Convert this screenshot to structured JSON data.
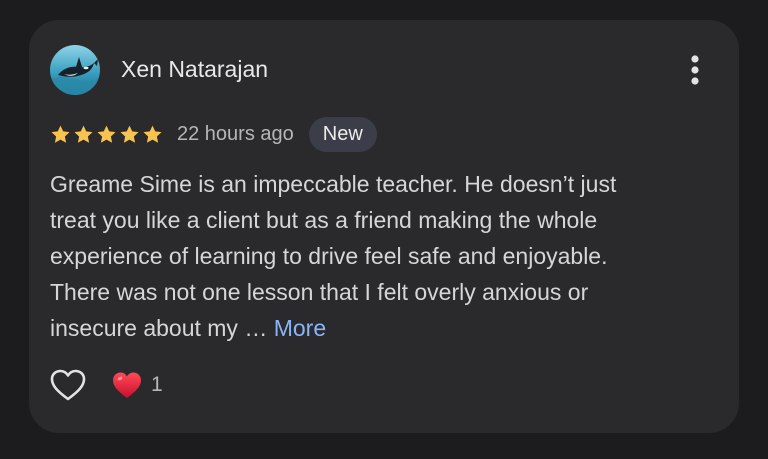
{
  "review": {
    "reviewer_name": "Xen Natarajan",
    "avatar_icon": "orca-avatar-icon",
    "rating": 5,
    "rating_max": 5,
    "time_ago": "22 hours ago",
    "badge": "New",
    "text_lines": [
      "Greame Sime is an impeccable teacher. He doesn’t just",
      "treat you like a client but as a friend making the whole",
      "experience of learning to drive feel safe and enjoyable.",
      "There was not one lesson that I felt overly anxious or",
      "insecure about my … "
    ],
    "more_label": "More"
  },
  "actions": {
    "like_icon": "heart-outline-icon",
    "reaction_icon": "red-heart-icon",
    "reaction_count": "1",
    "menu_icon": "more-vert-icon"
  },
  "colors": {
    "background": "#1c1c1e",
    "card": "#2a2a2c",
    "star": "#f8c44f",
    "link": "#8ab4f8",
    "badge_bg": "#3b3e48",
    "heart_red": "#e0263a"
  }
}
